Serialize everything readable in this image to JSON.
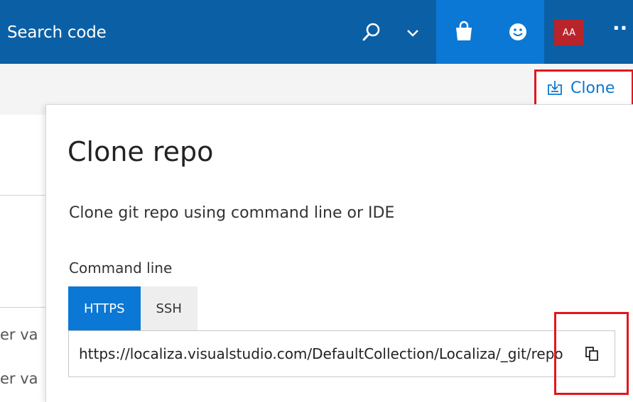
{
  "header": {
    "search_placeholder": "Search code",
    "user_initials": "AA",
    "more_glyph": "··",
    "colors": {
      "bar": "#0b5fa5",
      "active_button": "#0a78d4",
      "avatar": "#b8242a"
    }
  },
  "toolbar": {
    "clone_label": "Clone",
    "highlight_color": "#e1171e"
  },
  "background": {
    "row_text_1": "er va",
    "row_text_2": "er va"
  },
  "clone_panel": {
    "title": "Clone repo",
    "subtitle": "Clone git repo using command line or IDE",
    "section_label": "Command line",
    "tabs": [
      {
        "label": "HTTPS",
        "active": true
      },
      {
        "label": "SSH",
        "active": false
      }
    ],
    "url": "https://localiza.visualstudio.com/DefaultCollection/Localiza/_git/repo",
    "icons": {
      "copy": "copy-icon"
    }
  }
}
